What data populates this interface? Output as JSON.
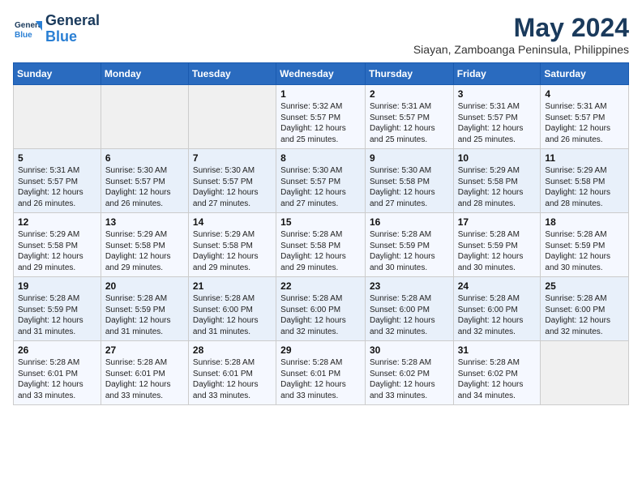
{
  "header": {
    "logo_line1": "General",
    "logo_line2": "Blue",
    "month": "May 2024",
    "location": "Siayan, Zamboanga Peninsula, Philippines"
  },
  "days_of_week": [
    "Sunday",
    "Monday",
    "Tuesday",
    "Wednesday",
    "Thursday",
    "Friday",
    "Saturday"
  ],
  "weeks": [
    [
      {
        "day": "",
        "info": ""
      },
      {
        "day": "",
        "info": ""
      },
      {
        "day": "",
        "info": ""
      },
      {
        "day": "1",
        "info": "Sunrise: 5:32 AM\nSunset: 5:57 PM\nDaylight: 12 hours\nand 25 minutes."
      },
      {
        "day": "2",
        "info": "Sunrise: 5:31 AM\nSunset: 5:57 PM\nDaylight: 12 hours\nand 25 minutes."
      },
      {
        "day": "3",
        "info": "Sunrise: 5:31 AM\nSunset: 5:57 PM\nDaylight: 12 hours\nand 25 minutes."
      },
      {
        "day": "4",
        "info": "Sunrise: 5:31 AM\nSunset: 5:57 PM\nDaylight: 12 hours\nand 26 minutes."
      }
    ],
    [
      {
        "day": "5",
        "info": "Sunrise: 5:31 AM\nSunset: 5:57 PM\nDaylight: 12 hours\nand 26 minutes."
      },
      {
        "day": "6",
        "info": "Sunrise: 5:30 AM\nSunset: 5:57 PM\nDaylight: 12 hours\nand 26 minutes."
      },
      {
        "day": "7",
        "info": "Sunrise: 5:30 AM\nSunset: 5:57 PM\nDaylight: 12 hours\nand 27 minutes."
      },
      {
        "day": "8",
        "info": "Sunrise: 5:30 AM\nSunset: 5:57 PM\nDaylight: 12 hours\nand 27 minutes."
      },
      {
        "day": "9",
        "info": "Sunrise: 5:30 AM\nSunset: 5:58 PM\nDaylight: 12 hours\nand 27 minutes."
      },
      {
        "day": "10",
        "info": "Sunrise: 5:29 AM\nSunset: 5:58 PM\nDaylight: 12 hours\nand 28 minutes."
      },
      {
        "day": "11",
        "info": "Sunrise: 5:29 AM\nSunset: 5:58 PM\nDaylight: 12 hours\nand 28 minutes."
      }
    ],
    [
      {
        "day": "12",
        "info": "Sunrise: 5:29 AM\nSunset: 5:58 PM\nDaylight: 12 hours\nand 29 minutes."
      },
      {
        "day": "13",
        "info": "Sunrise: 5:29 AM\nSunset: 5:58 PM\nDaylight: 12 hours\nand 29 minutes."
      },
      {
        "day": "14",
        "info": "Sunrise: 5:29 AM\nSunset: 5:58 PM\nDaylight: 12 hours\nand 29 minutes."
      },
      {
        "day": "15",
        "info": "Sunrise: 5:28 AM\nSunset: 5:58 PM\nDaylight: 12 hours\nand 29 minutes."
      },
      {
        "day": "16",
        "info": "Sunrise: 5:28 AM\nSunset: 5:59 PM\nDaylight: 12 hours\nand 30 minutes."
      },
      {
        "day": "17",
        "info": "Sunrise: 5:28 AM\nSunset: 5:59 PM\nDaylight: 12 hours\nand 30 minutes."
      },
      {
        "day": "18",
        "info": "Sunrise: 5:28 AM\nSunset: 5:59 PM\nDaylight: 12 hours\nand 30 minutes."
      }
    ],
    [
      {
        "day": "19",
        "info": "Sunrise: 5:28 AM\nSunset: 5:59 PM\nDaylight: 12 hours\nand 31 minutes."
      },
      {
        "day": "20",
        "info": "Sunrise: 5:28 AM\nSunset: 5:59 PM\nDaylight: 12 hours\nand 31 minutes."
      },
      {
        "day": "21",
        "info": "Sunrise: 5:28 AM\nSunset: 6:00 PM\nDaylight: 12 hours\nand 31 minutes."
      },
      {
        "day": "22",
        "info": "Sunrise: 5:28 AM\nSunset: 6:00 PM\nDaylight: 12 hours\nand 32 minutes."
      },
      {
        "day": "23",
        "info": "Sunrise: 5:28 AM\nSunset: 6:00 PM\nDaylight: 12 hours\nand 32 minutes."
      },
      {
        "day": "24",
        "info": "Sunrise: 5:28 AM\nSunset: 6:00 PM\nDaylight: 12 hours\nand 32 minutes."
      },
      {
        "day": "25",
        "info": "Sunrise: 5:28 AM\nSunset: 6:00 PM\nDaylight: 12 hours\nand 32 minutes."
      }
    ],
    [
      {
        "day": "26",
        "info": "Sunrise: 5:28 AM\nSunset: 6:01 PM\nDaylight: 12 hours\nand 33 minutes."
      },
      {
        "day": "27",
        "info": "Sunrise: 5:28 AM\nSunset: 6:01 PM\nDaylight: 12 hours\nand 33 minutes."
      },
      {
        "day": "28",
        "info": "Sunrise: 5:28 AM\nSunset: 6:01 PM\nDaylight: 12 hours\nand 33 minutes."
      },
      {
        "day": "29",
        "info": "Sunrise: 5:28 AM\nSunset: 6:01 PM\nDaylight: 12 hours\nand 33 minutes."
      },
      {
        "day": "30",
        "info": "Sunrise: 5:28 AM\nSunset: 6:02 PM\nDaylight: 12 hours\nand 33 minutes."
      },
      {
        "day": "31",
        "info": "Sunrise: 5:28 AM\nSunset: 6:02 PM\nDaylight: 12 hours\nand 34 minutes."
      },
      {
        "day": "",
        "info": ""
      }
    ]
  ]
}
